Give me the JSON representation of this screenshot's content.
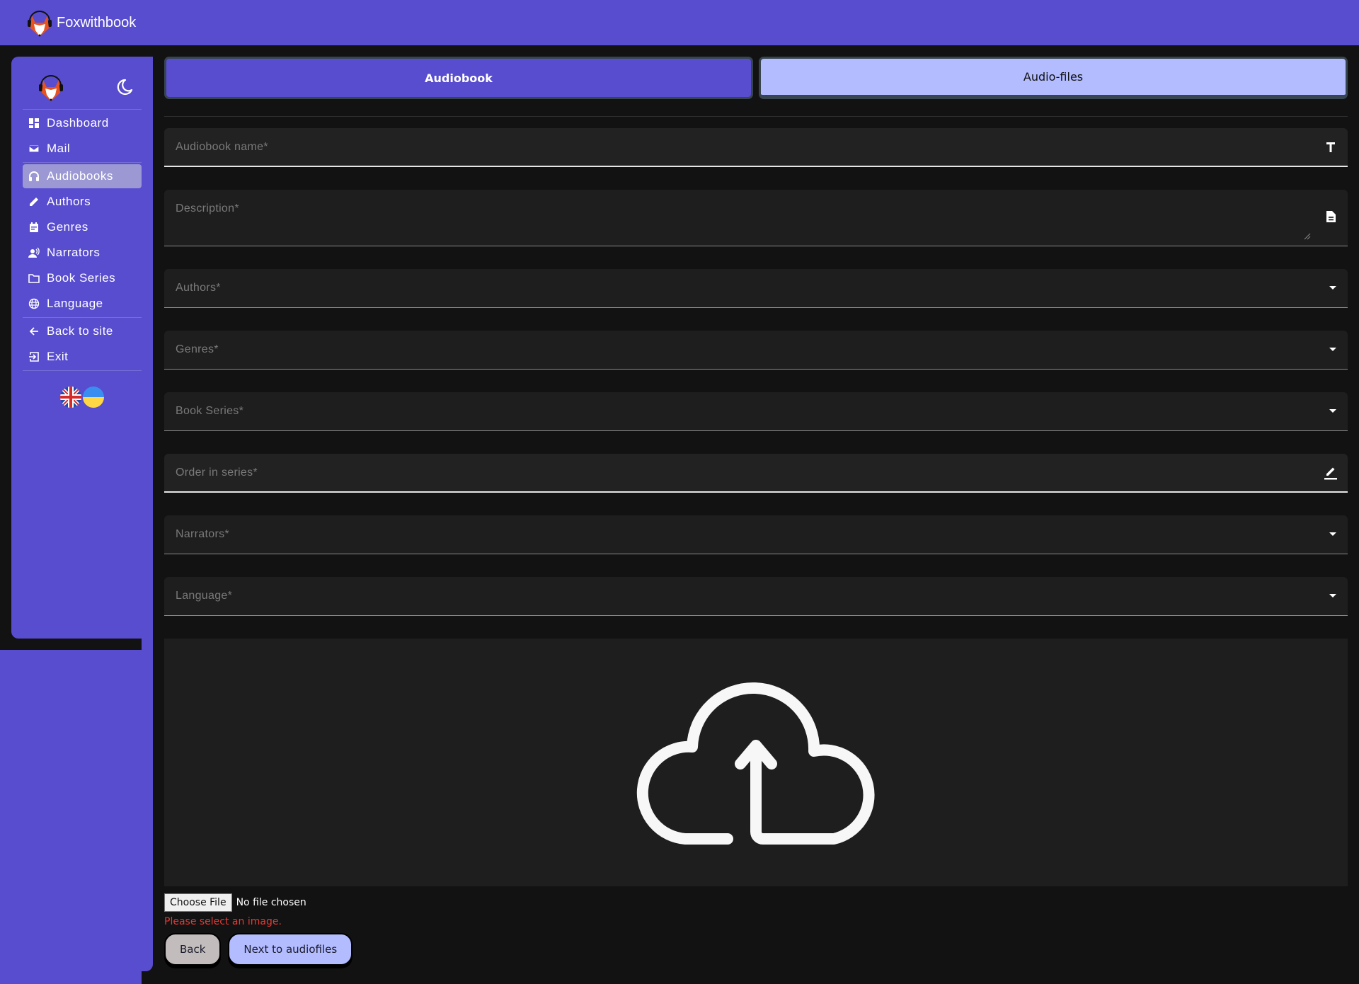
{
  "app": {
    "title": "Foxwithbook"
  },
  "sidebar": {
    "theme_toggle_icon": "moon-icon",
    "items": [
      {
        "label": "Dashboard",
        "icon": "dashboard-icon",
        "active": false
      },
      {
        "label": "Mail",
        "icon": "mail-icon",
        "active": false
      },
      {
        "label": "Audiobooks",
        "icon": "headphones-icon",
        "active": true
      },
      {
        "label": "Authors",
        "icon": "pencil-icon",
        "active": false
      },
      {
        "label": "Genres",
        "icon": "calendar-icon",
        "active": false
      },
      {
        "label": "Narrators",
        "icon": "voice-icon",
        "active": false
      },
      {
        "label": "Book Series",
        "icon": "folder-icon",
        "active": false
      },
      {
        "label": "Language",
        "icon": "globe-icon",
        "active": false
      }
    ],
    "secondary_items": [
      {
        "label": "Back to site",
        "icon": "arrow-left-icon"
      },
      {
        "label": "Exit",
        "icon": "exit-icon"
      }
    ],
    "languages": [
      "en",
      "uk"
    ]
  },
  "tabs": [
    {
      "label": "Audiobook",
      "active": true
    },
    {
      "label": "Audio-files",
      "active": false
    }
  ],
  "form": {
    "fields": {
      "name": {
        "label": "Audiobook name*",
        "icon": "text-format-icon"
      },
      "description": {
        "label": "Description*",
        "icon": "document-icon"
      },
      "authors": {
        "label": "Authors*"
      },
      "genres": {
        "label": "Genres*"
      },
      "book_series": {
        "label": "Book Series*"
      },
      "order": {
        "label": "Order in series*",
        "icon": "edit-icon"
      },
      "narrators": {
        "label": "Narrators*"
      },
      "language": {
        "label": "Language*"
      }
    },
    "upload": {
      "icon": "cloud-upload-icon",
      "choose_label": "Choose File",
      "file_status": "No file chosen",
      "error": "Please select an image."
    },
    "buttons": {
      "back": "Back",
      "next": "Next to audiofiles"
    }
  },
  "colors": {
    "brand": "#584ccf",
    "accent_light": "#b2bcff",
    "error": "#e53935",
    "background": "#121212"
  }
}
